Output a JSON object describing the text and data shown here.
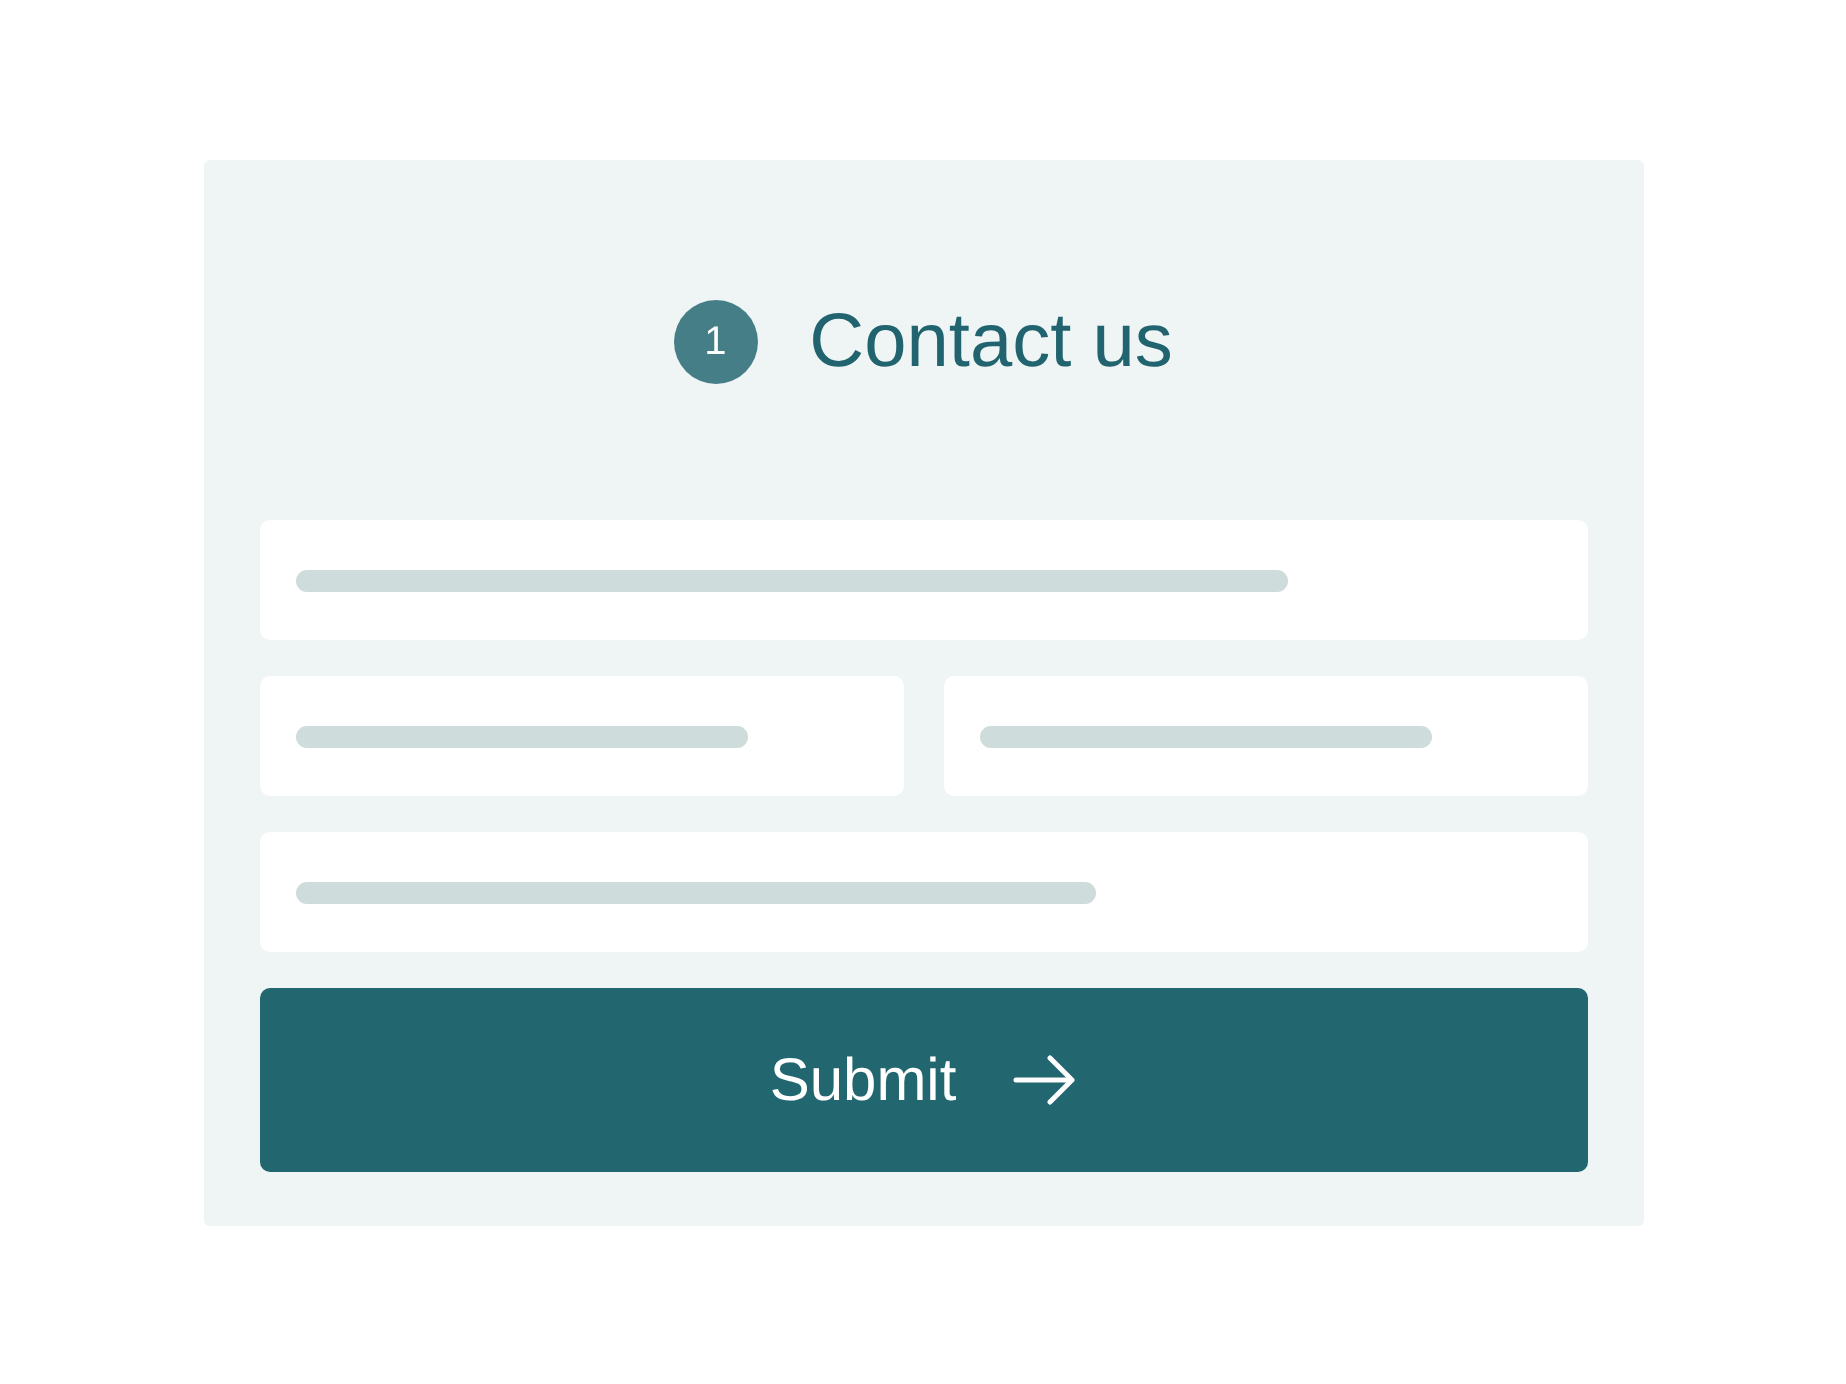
{
  "header": {
    "step": "1",
    "title": "Contact us"
  },
  "submit_button": {
    "label": "Submit"
  }
}
